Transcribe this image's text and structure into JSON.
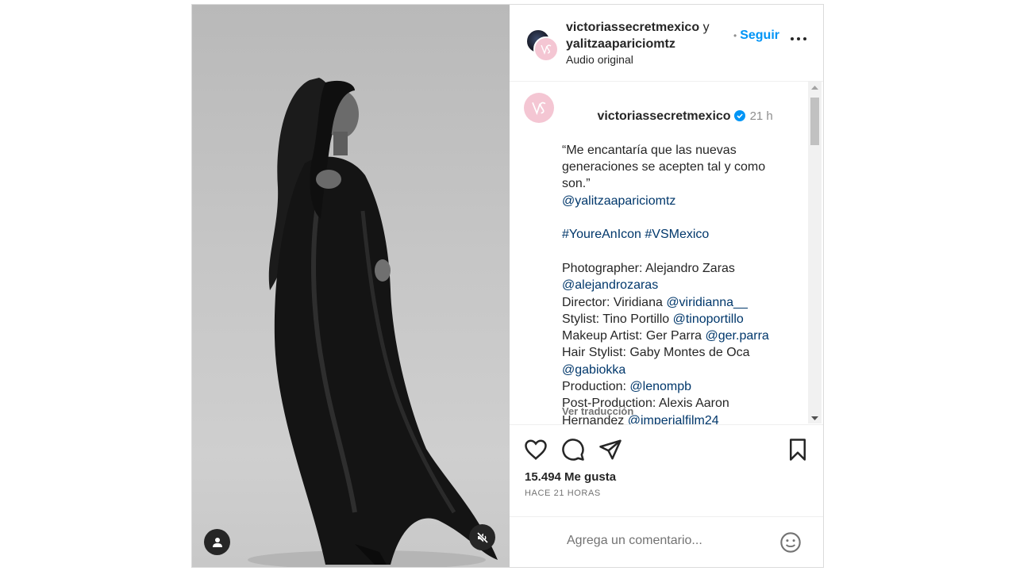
{
  "header": {
    "user1": "victoriassecretmexico",
    "conj": "y",
    "user2": "yalitzaapariciomtz",
    "audio": "Audio original",
    "follow_label": "Seguir",
    "follow_dot": "•"
  },
  "caption": {
    "username": "victoriassecretmexico",
    "time": "21 h",
    "quote1": "“Me encantaría que las nuevas",
    "quote2": "generaciones se acepten tal y como",
    "quote3": "son.”",
    "mention_star": "@yalitzaapariciomtz",
    "hashtag1": "#YoureAnIcon",
    "hashtag2": "#VSMexico",
    "photographer_label": "Photographer: Alejandro Zaras",
    "photographer_handle": "@alejandrozaras",
    "director_label": "Director: Viridiana ",
    "director_handle": "@viridianna__",
    "stylist_label": "Stylist: Tino Portillo ",
    "stylist_handle": "@tinoportillo",
    "makeup_label": "Makeup Artist: Ger Parra ",
    "makeup_handle": "@ger.parra",
    "hair_label": "Hair Stylist: Gaby Montes de Oca",
    "hair_handle": "@gabiokka",
    "production_label": "Production: ",
    "production_handle": "@lenompb",
    "post_label1": "Post-Production: Alexis Aaron",
    "post_label2": "Hernandez ",
    "post_handle": "@imperialfilm24",
    "translate": "Ver traducción"
  },
  "stats": {
    "likes": "15.494 Me gusta",
    "ago": "HACE 21 HORAS"
  },
  "comment_box": {
    "placeholder": "Agrega un comentario..."
  },
  "icons": {
    "like": "heart-icon",
    "comment": "comment-bubble-icon",
    "share": "paper-plane-icon",
    "save": "bookmark-icon",
    "more": "more-dots-icon",
    "emoji": "emoji-icon",
    "user_tag": "user-tag-icon",
    "mute": "speaker-muted-icon",
    "verified": "verified-badge-icon"
  },
  "colors": {
    "accent": "#0095f6",
    "link": "#00376b",
    "verified": "#0095f6",
    "brand_avatar": "#f4c6d3"
  }
}
